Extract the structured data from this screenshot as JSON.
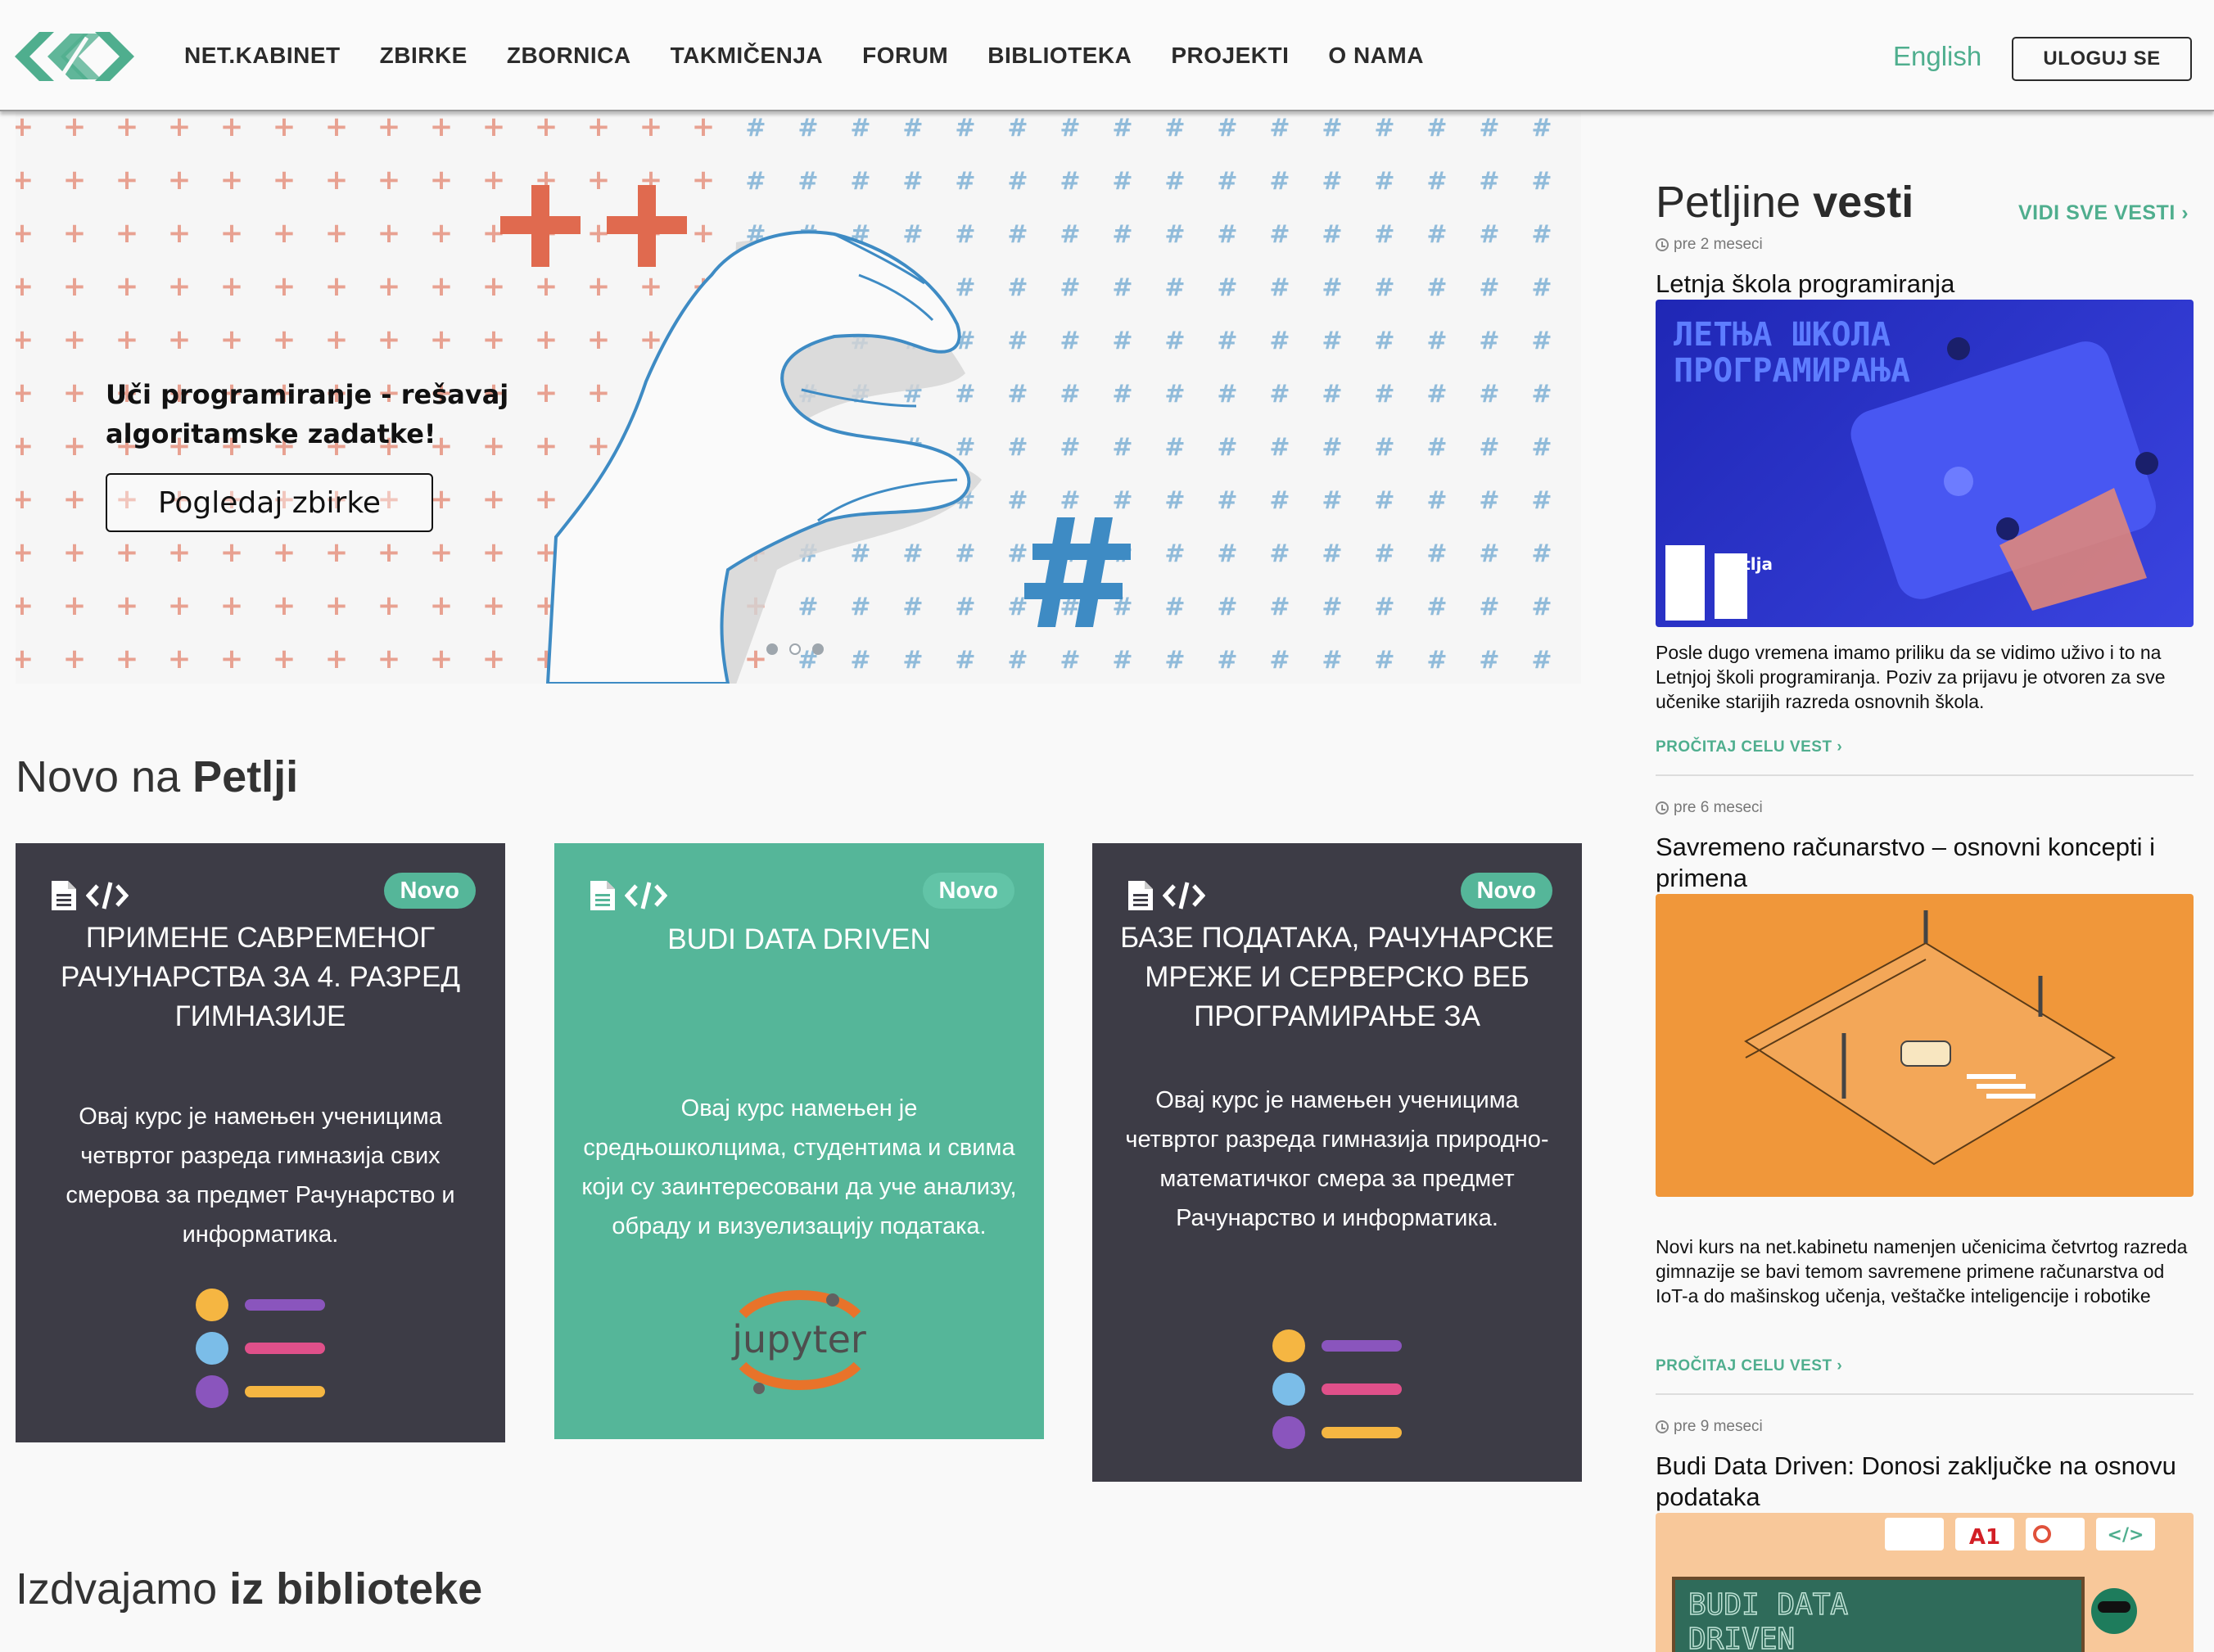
{
  "header": {
    "nav": [
      "NET.KABINET",
      "ZBIRKE",
      "ZBORNICA",
      "TAKMIČENJA",
      "FORUM",
      "BIBLIOTEKA",
      "PROJEKTI",
      "O NAMA"
    ],
    "language_link": "English",
    "login_label": "ULOGUJ SE"
  },
  "hero": {
    "tagline": "Uči programiranje - rešavaj algoritamske zadatke!",
    "button_label": "Pogledaj zbirke",
    "slides_total": 3,
    "active_slide": 2
  },
  "sections": {
    "new_prefix": "Novo na ",
    "new_bold": "Petlji",
    "library_prefix": "Izdvajamo ",
    "library_bold": "iz biblioteke"
  },
  "cards": [
    {
      "badge": "Novo",
      "title": "ПРИМЕНЕ САВРЕМЕНОГ РАЧУНАРСТВА ЗА 4. РАЗРЕД ГИМНАЗИЈЕ",
      "description": "Овај курс је намењен ученицима четвртог разреда гимназија свих смерова за предмет Рачунарство и информатика.",
      "icon": "list-icon"
    },
    {
      "badge": "Novo",
      "title": "BUDI DATA DRIVEN",
      "description": "Овај курс намењен је средњошколцима, студентима и свима који су заинтересовани да уче анализу, обраду и визуелизацију података.",
      "icon": "jupyter-logo",
      "logo_text": "jupyter"
    },
    {
      "badge": "Novo",
      "title": "БАЗЕ ПОДАТАКА, РАЧУНАРСКЕ МРЕЖЕ И СЕРВЕРСКО ВЕБ ПРОГРАМИРАЊЕ ЗА",
      "description": "Овај курс је намењен ученицима четвртог разреда гимназија природно-математичког смера за предмет Рачунарство и информатика.",
      "icon": "list-icon"
    }
  ],
  "news": {
    "title_prefix": "Petljine ",
    "title_bold": "vesti",
    "see_all": "VIDI SVE VESTI ›",
    "read_more": "PROČITAJ CELU VEST ›",
    "items": [
      {
        "time": "pre 2 meseci",
        "headline": "Letnja škola programiranja",
        "text": "Posle dugo vremena imamo priliku da se vidimo uživo i to na Letnjoj školi programiranja. Poziv za prijavu je otvoren za sve učenike starijih razreda osnovnih škola.",
        "image_text_1": "ЛЕТЊА ШКОЛА",
        "image_text_2": "ПРОГРАМИРАЊА",
        "image_brand": "Petlja",
        "image_colors": [
          "#1f27b5",
          "#3a44e0"
        ]
      },
      {
        "time": "pre 6 meseci",
        "headline": "Savremeno računarstvo – osnovni koncepti i primena",
        "text": "Novi kurs na net.kabinetu namenjen učenicima četvrtog razreda gimnazije se bavi temom savremene primene računarstva od IoT-a do mašinskog učenja, veštačke inteligencije i robotike",
        "image_colors": [
          "#f0973a",
          "#e58525"
        ]
      },
      {
        "time": "pre 9 meseci",
        "headline": "Budi Data Driven: Donosi zaključke na osnovu podataka",
        "image_text_1": "BUDI DATA",
        "image_text_2": "DRIVEN",
        "image_colors": [
          "#f8c89a",
          "#2f6b5a"
        ]
      }
    ]
  },
  "colors": {
    "accent": "#4fae8e",
    "card_dark": "#3d3c46",
    "card_green": "#55b699",
    "plus_red": "#e06a4f",
    "hash_blue": "#3e8bc4"
  }
}
